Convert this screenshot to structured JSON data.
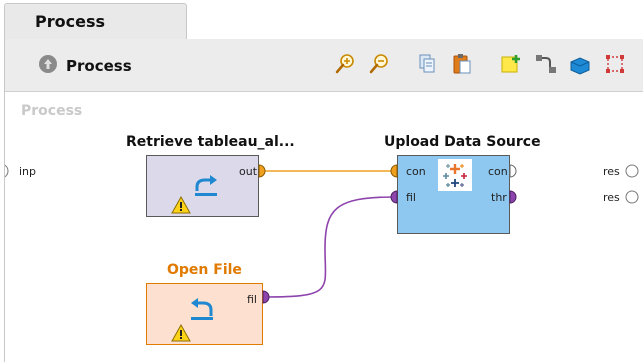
{
  "tab": {
    "label": "Process"
  },
  "toolbar": {
    "title": "Process",
    "buttons": [
      {
        "name": "zoom-in-icon"
      },
      {
        "name": "zoom-out-icon"
      },
      {
        "name": "copy-icon"
      },
      {
        "name": "paste-icon"
      },
      {
        "name": "add-note-icon"
      },
      {
        "name": "auto-wire-icon"
      },
      {
        "name": "layer-icon"
      },
      {
        "name": "arrange-icon"
      }
    ]
  },
  "canvas": {
    "label": "Process",
    "left_port": "inp",
    "right_ports": [
      "res",
      "res"
    ]
  },
  "operators": {
    "retrieve": {
      "title": "Retrieve tableau_al...",
      "ports": {
        "out": "out"
      },
      "warning": true
    },
    "upload": {
      "title": "Upload Data Source",
      "ports": {
        "con_in": "con",
        "fil_in": "fil",
        "con_out": "con",
        "thr_out": "thr"
      }
    },
    "open_file": {
      "title": "Open File",
      "ports": {
        "fil_out": "fil"
      },
      "warning": true
    }
  },
  "colors": {
    "orange_wire": "#f0a020",
    "purple_wire": "#8e44ad",
    "retrieve_bg": "#dcdaea",
    "upload_bg": "#8ec8f0",
    "open_file_bg": "#fde0cf",
    "open_file_title": "#e07a00"
  }
}
